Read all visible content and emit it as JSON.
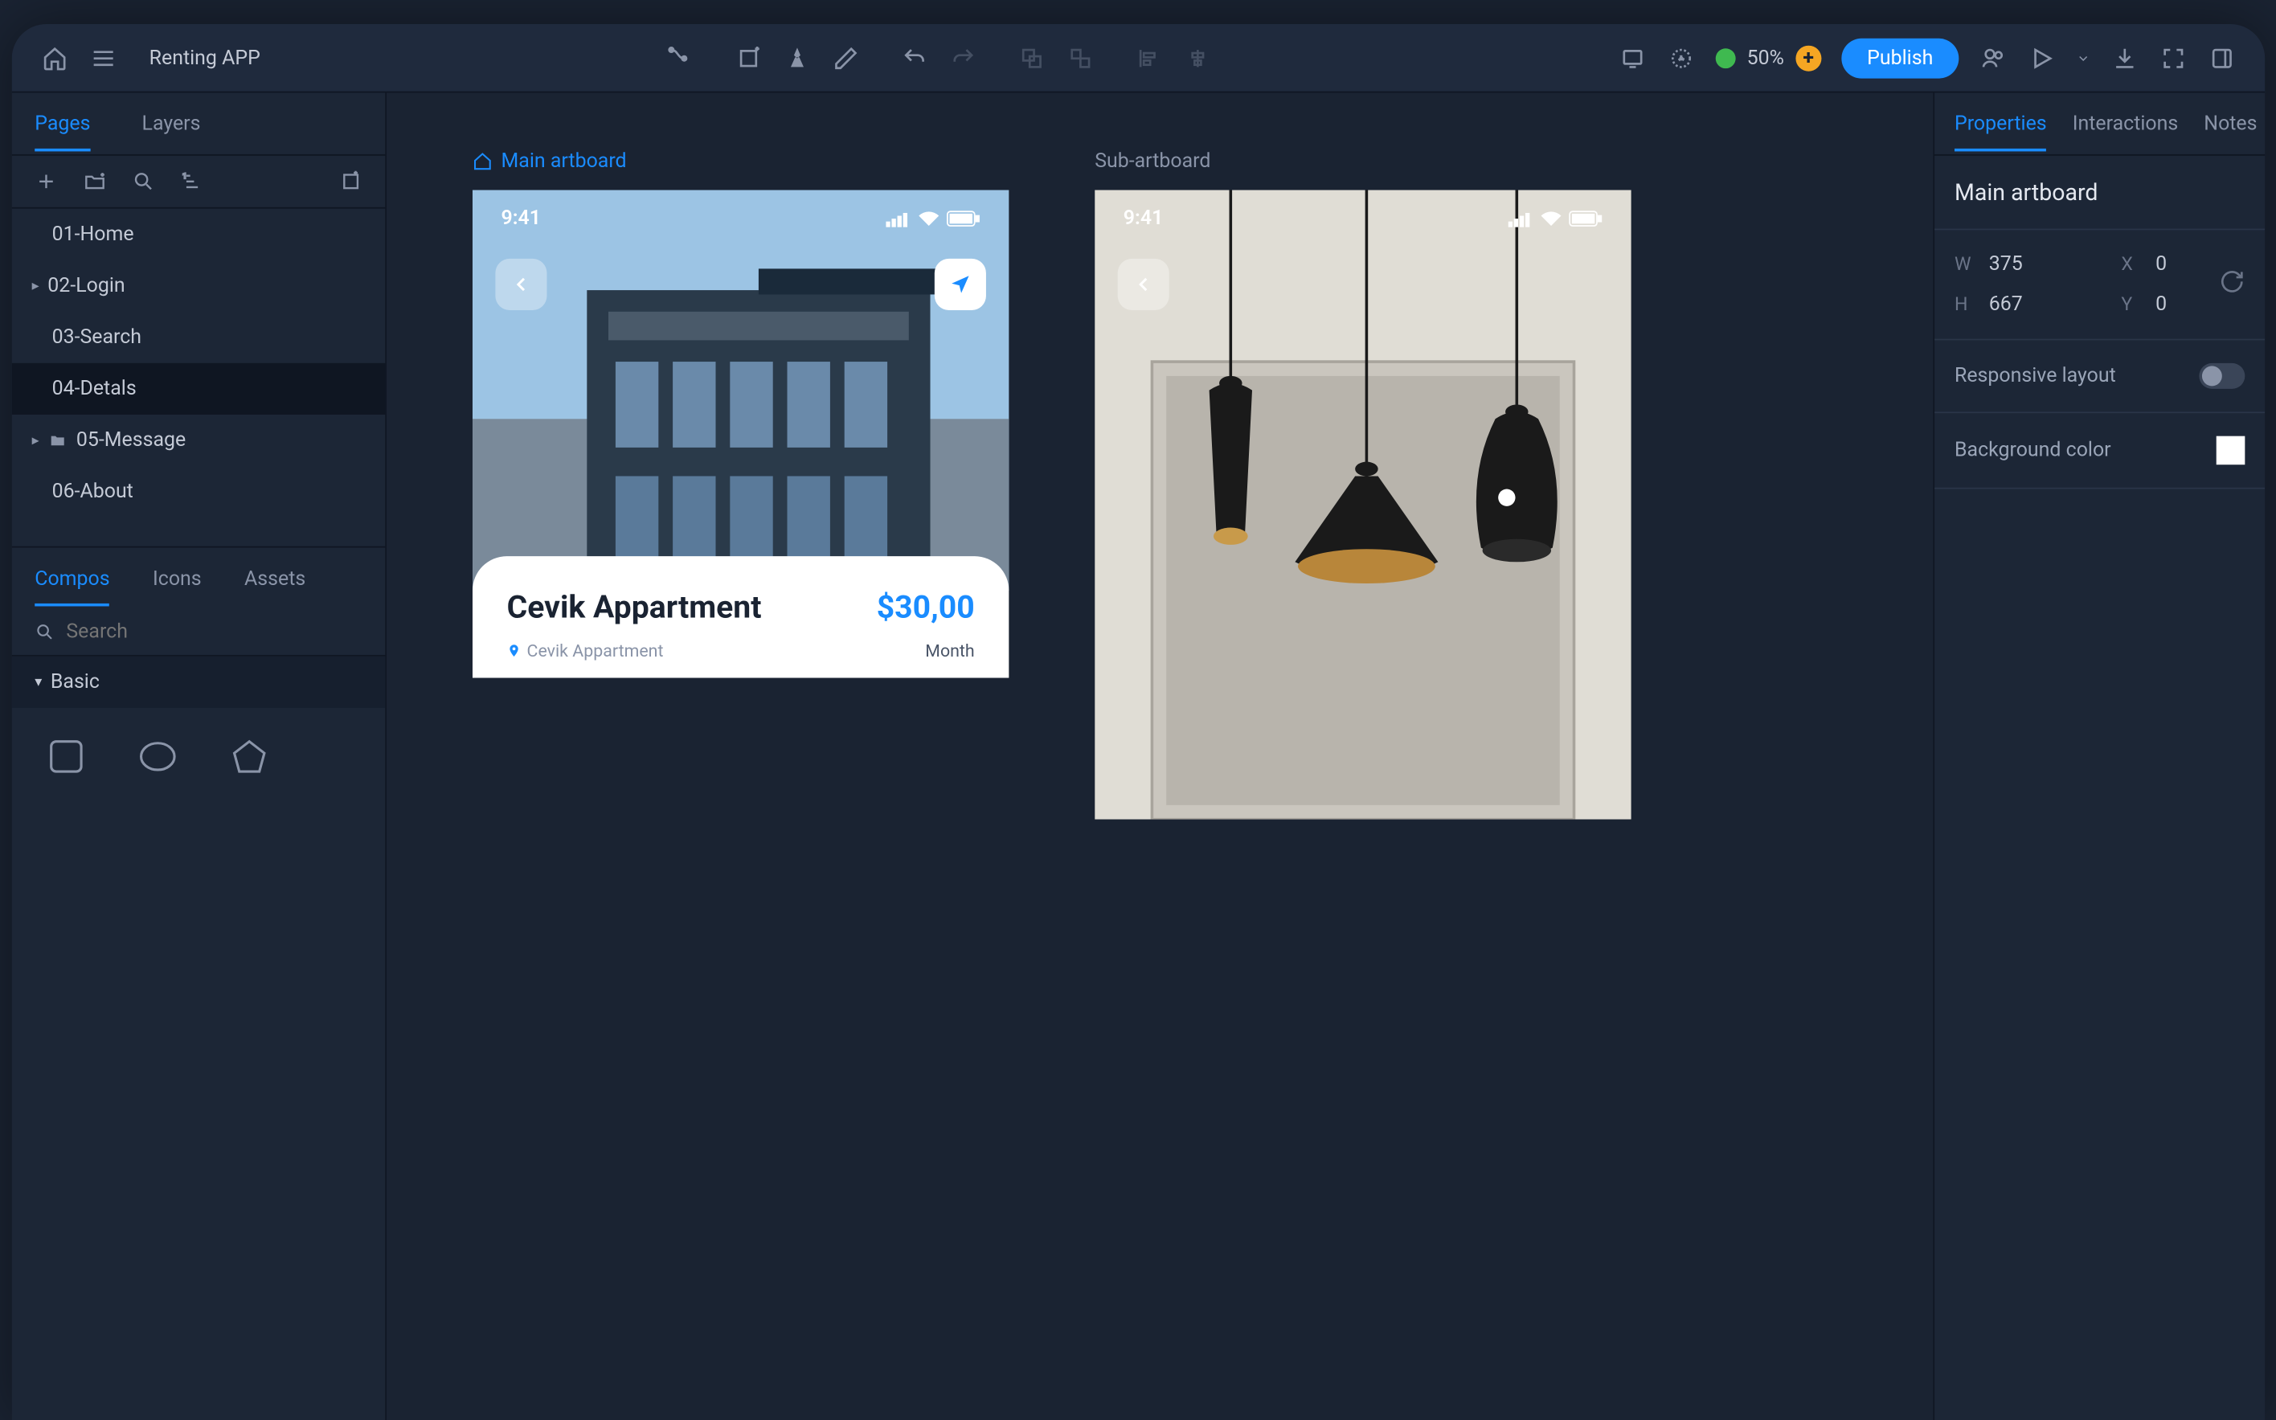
{
  "project_name": "Renting APP",
  "topbar": {
    "zoom": "50%",
    "publish_label": "Publish"
  },
  "left_panel": {
    "tabs": [
      "Pages",
      "Layers"
    ],
    "active_tab": 0,
    "pages": [
      {
        "label": "01-Home",
        "expandable": false,
        "selected": false
      },
      {
        "label": "02-Login",
        "expandable": true,
        "selected": false
      },
      {
        "label": "03-Search",
        "expandable": false,
        "selected": false
      },
      {
        "label": "04-Detals",
        "expandable": false,
        "selected": true
      },
      {
        "label": "05-Message",
        "expandable": true,
        "folder": true,
        "selected": false
      },
      {
        "label": "06-About",
        "expandable": false,
        "selected": false
      }
    ],
    "lib_tabs": [
      "Compos",
      "Icons",
      "Assets"
    ],
    "lib_active": 0,
    "search_placeholder": "Search",
    "category": "Basic"
  },
  "canvas": {
    "artboards": [
      {
        "label": "Main artboard",
        "primary": true
      },
      {
        "label": "Sub-artboard",
        "primary": false
      }
    ],
    "mockup1": {
      "time": "9:41",
      "title": "Cevik Appartment",
      "price": "$30,00",
      "location": "Cevik Appartment",
      "period": "Month"
    },
    "mockup2": {
      "time": "9:41"
    }
  },
  "right_panel": {
    "tabs": [
      "Properties",
      "Interactions",
      "Notes"
    ],
    "active_tab": 0,
    "title": "Main artboard",
    "dims": {
      "w_label": "W",
      "w": "375",
      "h_label": "H",
      "h": "667",
      "x_label": "X",
      "x": "0",
      "y_label": "Y",
      "y": "0"
    },
    "responsive_label": "Responsive layout",
    "bg_label": "Background color",
    "bg_color": "#ffffff"
  }
}
